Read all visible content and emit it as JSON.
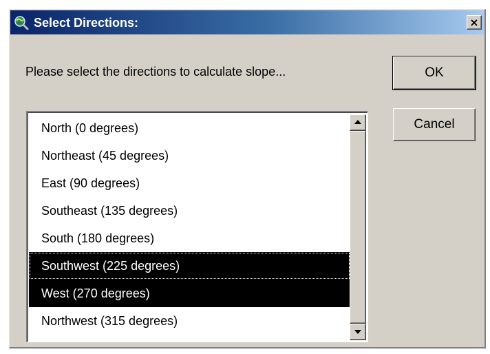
{
  "window": {
    "title": "Select Directions:",
    "close_label": "×",
    "icon": "globe-magnifier-icon"
  },
  "prompt": "Please select the directions to calculate slope...",
  "buttons": {
    "ok": "OK",
    "cancel": "Cancel"
  },
  "directions": [
    {
      "label": "North (0 degrees)",
      "selected": false
    },
    {
      "label": "Northeast (45 degrees)",
      "selected": false
    },
    {
      "label": "East (90 degrees)",
      "selected": false
    },
    {
      "label": "Southeast (135 degrees)",
      "selected": false
    },
    {
      "label": "South (180 degrees)",
      "selected": false
    },
    {
      "label": "Southwest (225 degrees)",
      "selected": true,
      "focused": true
    },
    {
      "label": "West (270 degrees)",
      "selected": true
    },
    {
      "label": "Northwest (315 degrees)",
      "selected": false
    }
  ],
  "colors": {
    "titlebar_start": "#0a246a",
    "titlebar_end": "#a6caf0",
    "dialog_bg": "#d4d0c8",
    "selection_bg": "#000000",
    "selection_text": "#ffffff"
  }
}
